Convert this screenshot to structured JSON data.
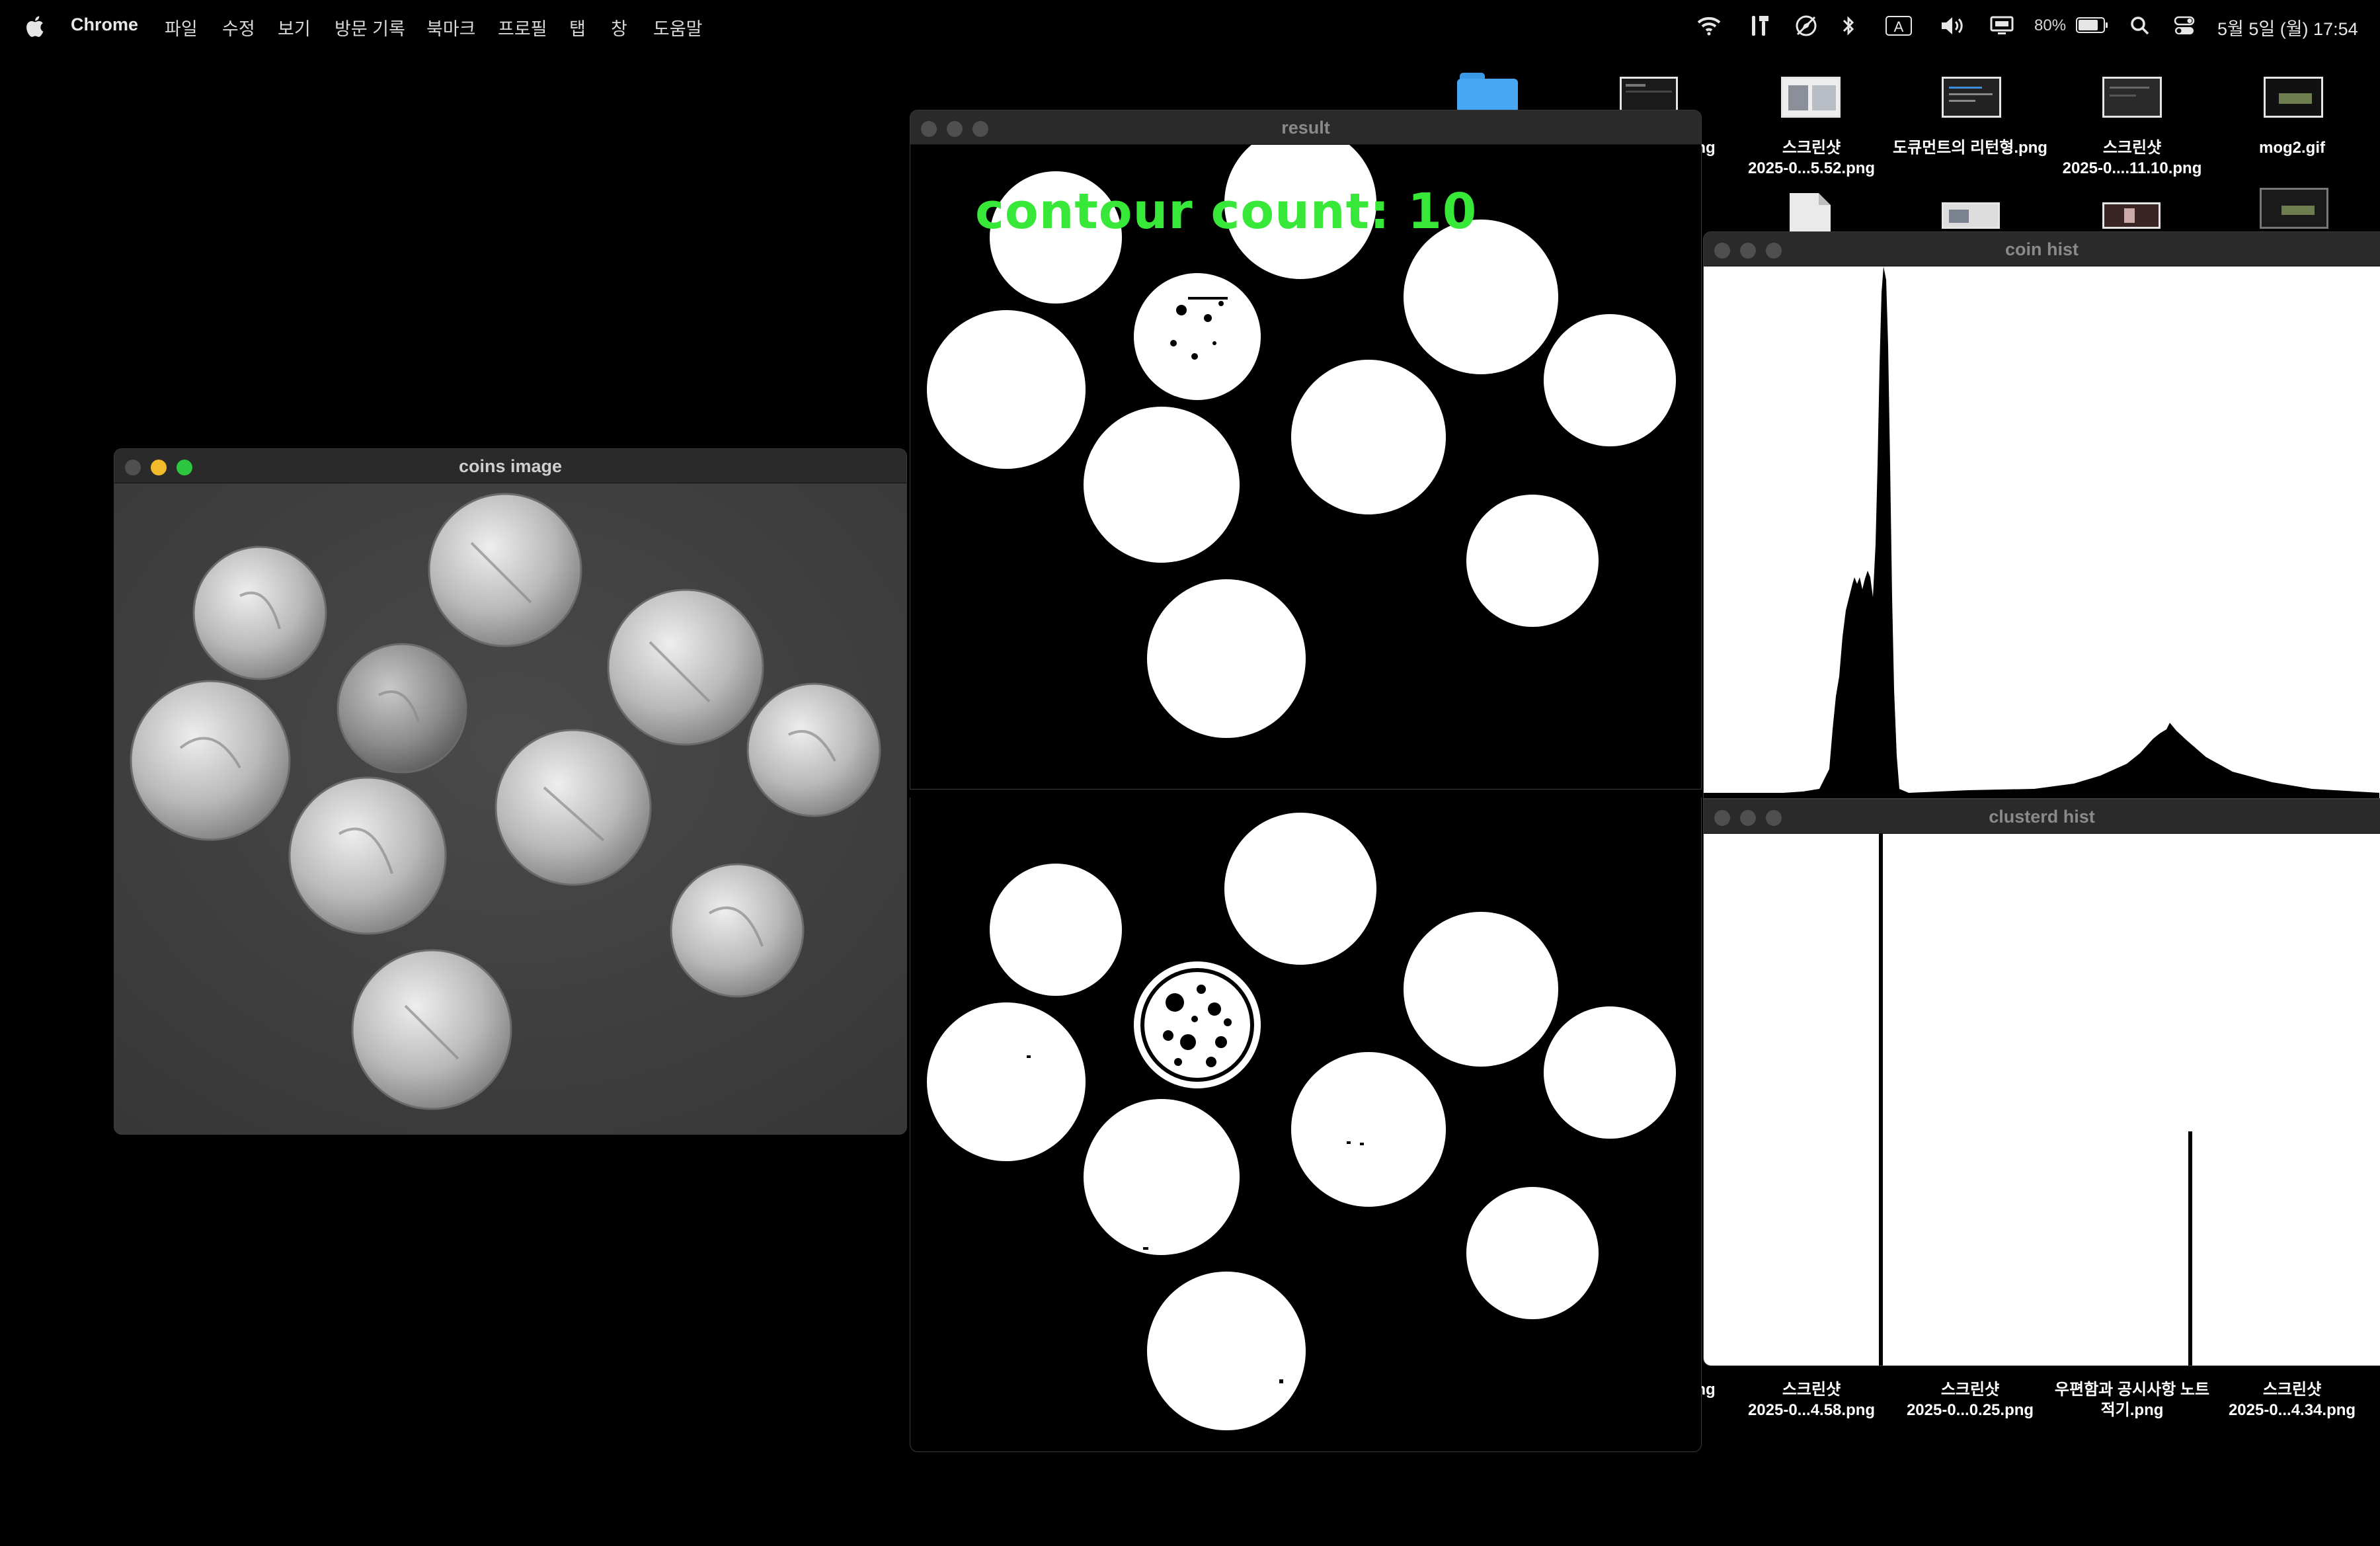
{
  "menubar": {
    "app_name": "Chrome",
    "items": [
      "파일",
      "수정",
      "보기",
      "방문 기록",
      "북마크",
      "프로필",
      "탭",
      "창",
      "도움말"
    ],
    "status": {
      "input_badge": "A",
      "battery_percent": "80%",
      "battery_level": 0.8,
      "datetime": "5월 5일 (월) 17:54"
    }
  },
  "desktop": {
    "top_icons": [
      {
        "line1": "ng",
        "line2": ""
      },
      {
        "line1": "스크린샷",
        "line2": "2025-0...5.52.png"
      },
      {
        "line1": "도큐먼트의 리턴형.png",
        "line2": ""
      },
      {
        "line1": "스크린샷",
        "line2": "2025-0....11.10.png"
      },
      {
        "line1": "mog2.gif",
        "line2": ""
      }
    ],
    "bottom_icons": [
      {
        "line1": "ng",
        "line2": ""
      },
      {
        "line1": "스크린샷",
        "line2": "2025-0...4.58.png"
      },
      {
        "line1": "스크린샷",
        "line2": "2025-0...0.25.png"
      },
      {
        "line1": "우편함과 공시사항 노트",
        "line2": "적기.png"
      },
      {
        "line1": "스크린샷",
        "line2": "2025-0...4.34.png"
      }
    ]
  },
  "windows": {
    "coins": {
      "title": "coins image"
    },
    "result": {
      "title": "result",
      "overlay_text": "contour count: 10"
    },
    "coin_hist": {
      "title": "coin hist"
    },
    "clustered_hist": {
      "title": "clusterd hist",
      "peaks": [
        0.0,
        0.37
      ],
      "peak_heights": [
        1.0,
        0.44
      ]
    }
  },
  "colors": {
    "overlay_text": "#38e838",
    "titlebar": "#2a2a2a",
    "desktop": "#000000",
    "folder": "#48a7f3"
  }
}
